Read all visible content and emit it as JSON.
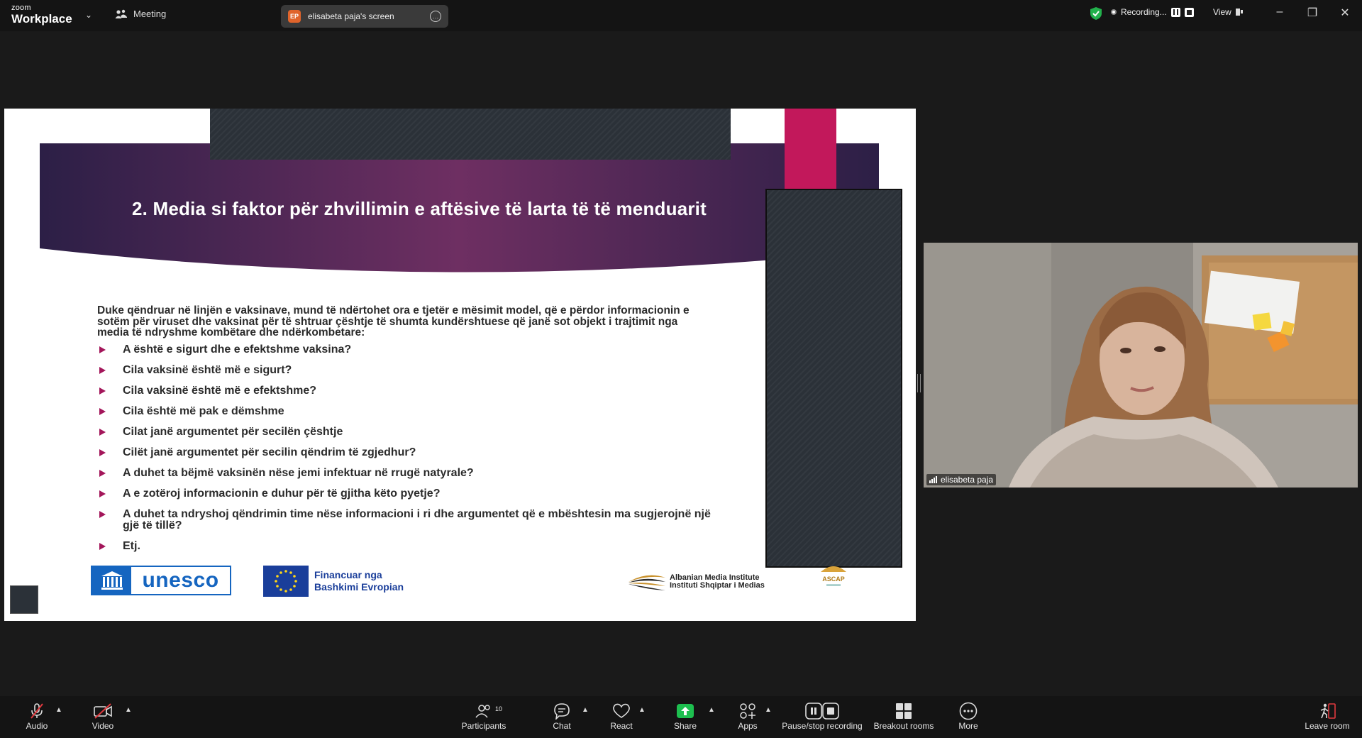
{
  "app": {
    "brand_small": "zoom",
    "brand_large": "Workplace",
    "meeting_label": "Meeting",
    "screen_share": {
      "initials": "EP",
      "label": "elisabeta paja's screen"
    },
    "recording_label": "Recording...",
    "view_label": "View"
  },
  "slide": {
    "title": "2. Media si faktor për zhvillimin e aftësive të larta të të menduarit",
    "intro_lines": [
      "Duke qëndruar  në linjën e vaksinave, mund të ndërtohet ora e tjetër e mësimit model, që e përdor informacionin e",
      "sotëm për viruset dhe vaksinat për të  shtruar çështje të shumta kundërshtuese që janë sot objekt i trajtimit nga",
      "media të ndryshme kombëtare dhe ndërkombetare:"
    ],
    "questions": [
      "A është e sigurt dhe e efektshme vaksina?",
      "Cila vaksinë është më e sigurt?",
      "Cila vaksinë është më  e efektshme?",
      "Cila është më pak e dëmshme",
      "Cilat janë argumentet për secilën çështje",
      "Cilët janë argumentet për secilin qëndrim të zgjedhur?",
      "A duhet ta bëjmë vaksinën nëse jemi infektuar në rrugë natyrale?",
      "A e zotëroj informacionin e duhur për të gjitha këto pyetje?",
      "A duhet ta ndryshoj qëndrimin time nëse informacioni i ri dhe argumentet që e mbështesin ma sugjerojnë një",
      "gjë të tillë?",
      "Etj."
    ],
    "logos": {
      "unesco": "unesco",
      "eu_line1": "Financuar nga",
      "eu_line2": "Bashkimi Evropian",
      "ami_line1": "Albanian Media Institute",
      "ami_line2": "Instituti Shqiptar i Medias",
      "ascap": "ASCAP"
    }
  },
  "video": {
    "participant_name": "elisabeta paja"
  },
  "toolbar": {
    "audio": "Audio",
    "video": "Video",
    "participants": "Participants",
    "participants_count": "10",
    "chat": "Chat",
    "react": "React",
    "share": "Share",
    "apps": "Apps",
    "pause_stop": "Pause/stop recording",
    "breakout": "Breakout rooms",
    "more": "More",
    "leave": "Leave room"
  },
  "colors": {
    "banner_dark": "#2c1f46",
    "banner_mid": "#6e2f62",
    "accent_pink": "#c2185b",
    "bullet": "#a3165a",
    "share_green": "#1dbf4f",
    "leave_red": "#e0393e"
  }
}
